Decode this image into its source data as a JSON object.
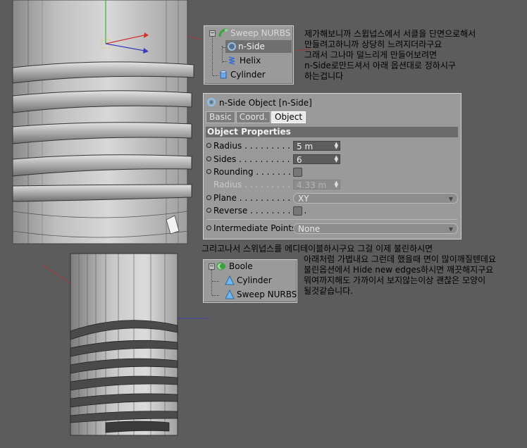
{
  "tree_top": {
    "items": [
      {
        "label": "Sweep NURBS",
        "icon": "sweep-nurbs-icon",
        "state": "disabled"
      },
      {
        "label": "n-Side",
        "icon": "n-side-icon",
        "state": "selected"
      },
      {
        "label": "Helix",
        "icon": "helix-icon",
        "state": "normal"
      },
      {
        "label": "Cylinder",
        "icon": "cylinder-icon",
        "state": "normal"
      }
    ]
  },
  "attributes": {
    "header": "n-Side Object [n-Side]",
    "tabs": [
      "Basic",
      "Coord.",
      "Object"
    ],
    "active_tab": "Object",
    "section": "Object Properties",
    "radius_label": "Radius",
    "radius_value": "5 m",
    "sides_label": "Sides",
    "sides_value": "6",
    "rounding_label": "Rounding",
    "sub_radius_label": "Radius",
    "sub_radius_value": "4.33 m",
    "plane_label": "Plane",
    "plane_value": "XY",
    "reverse_label": "Reverse",
    "intermediate_label": "Intermediate Points",
    "intermediate_value": "None"
  },
  "tree_bottom": {
    "items": [
      {
        "label": "Boole",
        "icon": "boole-icon"
      },
      {
        "label": "Cylinder",
        "icon": "cylinder-icon"
      },
      {
        "label": "Sweep NURBS",
        "icon": "sweep-nurbs-icon"
      }
    ]
  },
  "notes": {
    "top": [
      "제가해보니까 스윕넙스에서 서클을 단면으로해서",
      "만들려고하니까 상당히 느려지더라구요",
      "그래서 그나마 덜느리게 만들어보려면",
      "n-Side로만드셔서 아래 옵션대로 정하시구",
      "하는겁니다"
    ],
    "bottom_first": "그리고나서 스위넙스를 에디테이블하시구요 그걸 이제 불린하시면",
    "bottom": [
      "아래처럼 가볍내요 그런데 했을때 면이 많이깨질텐데요",
      "불린옵션에서 Hide new edges하시면 깨끗해지구요",
      "뭐여까지해도 가까이서 보지않는이상 괜찮은 모양이",
      "될것같습니다."
    ]
  },
  "colors": {
    "viewport": "#5c5c5c",
    "panel": "#9a9a9a",
    "selection": "#6f6f6f",
    "section": "#6b6b6b"
  }
}
